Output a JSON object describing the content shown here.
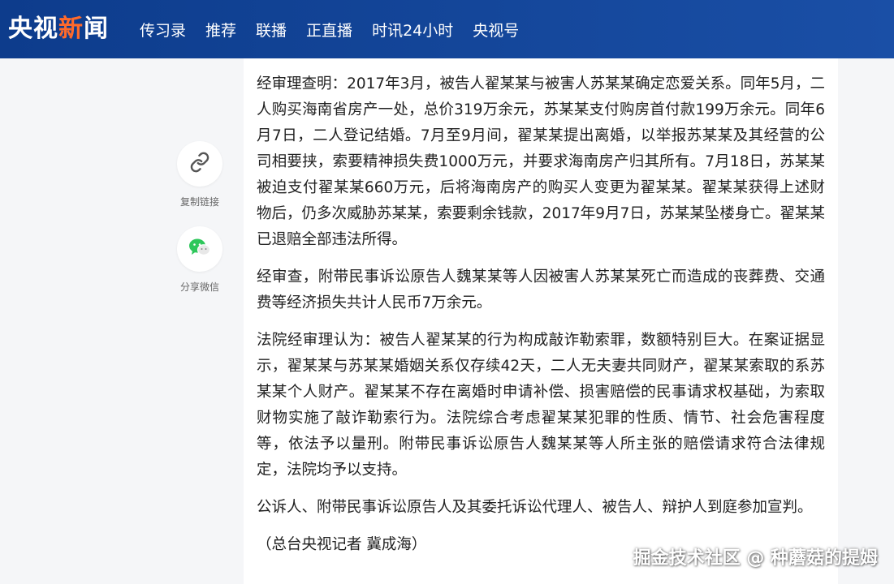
{
  "header": {
    "logo": {
      "part1": "央视",
      "part2": "新",
      "part3": "闻"
    },
    "nav": [
      "传习录",
      "推荐",
      "联播",
      "正直播",
      "时讯24小时",
      "央视号"
    ]
  },
  "side_actions": {
    "copy_link_label": "复制链接",
    "share_wechat_label": "分享微信"
  },
  "article": {
    "paragraphs": [
      "经审理查明：2017年3月，被告人翟某某与被害人苏某某确定恋爱关系。同年5月，二人购买海南省房产一处，总价319万余元，苏某某支付购房首付款199万余元。同年6月7日，二人登记结婚。7月至9月间，翟某某提出离婚，以举报苏某某及其经营的公司相要挟，索要精神损失费1000万元，并要求海南房产归其所有。7月18日，苏某某被迫支付翟某某660万元，后将海南房产的购买人变更为翟某某。翟某某获得上述财物后，仍多次威胁苏某某，索要剩余钱款，2017年9月7日，苏某某坠楼身亡。翟某某已退赔全部违法所得。",
      "经审查，附带民事诉讼原告人魏某某等人因被害人苏某某死亡而造成的丧葬费、交通费等经济损失共计人民币7万余元。",
      "法院经审理认为：被告人翟某某的行为构成敲诈勒索罪，数额特别巨大。在案证据显示，翟某某与苏某某婚姻关系仅存续42天，二人无夫妻共同财产，翟某某索取的系苏某某个人财产。翟某某不存在离婚时申请补偿、损害赔偿的民事请求权基础，为索取财物实施了敲诈勒索行为。法院综合考虑翟某某犯罪的性质、情节、社会危害程度等，依法予以量刑。附带民事诉讼原告人魏某某等人所主张的赔偿请求符合法律规定，法院均予以支持。",
      "公诉人、附带民事诉讼原告人及其委托诉讼代理人、被告人、辩护人到庭参加宣判。"
    ],
    "byline": "（总台央视记者 冀成海）"
  },
  "watermark": "掘金技术社区 @ 种蘑菇的提姆",
  "colors": {
    "header_bg": "#0d3c8c",
    "logo_accent": "#ff6a2b",
    "wechat_green": "#2ec75b",
    "page_bg": "#f5f6f8"
  }
}
